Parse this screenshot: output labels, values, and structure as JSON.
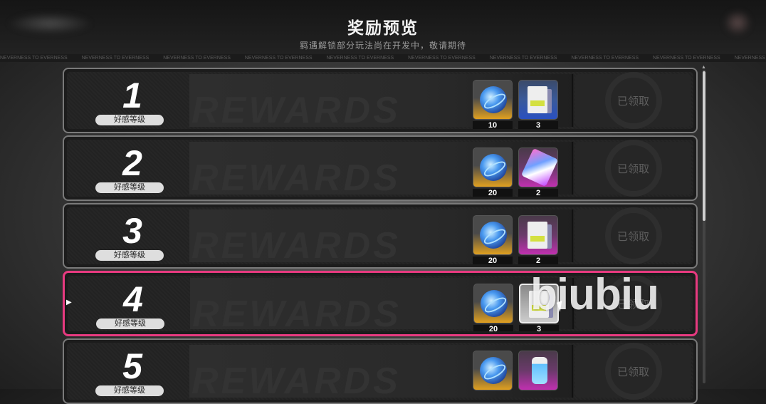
{
  "header": {
    "title": "奖励预览",
    "subtitle": "羁遇解锁部分玩法尚在开发中，敬请期待"
  },
  "ticker": {
    "text": "NEVERNESS TO EVERNESS"
  },
  "rows": [
    {
      "level": "1",
      "label": "好感等级",
      "status": "已领取",
      "items": [
        {
          "icon": "blue-orb-icon",
          "qty": "10"
        },
        {
          "icon": "blue-card-icon",
          "qty": "3"
        }
      ]
    },
    {
      "level": "2",
      "label": "好感等级",
      "status": "已领取",
      "items": [
        {
          "icon": "blue-orb-icon",
          "qty": "20"
        },
        {
          "icon": "pink-confetti-icon",
          "qty": "2"
        }
      ]
    },
    {
      "level": "3",
      "label": "好感等级",
      "status": "已领取",
      "items": [
        {
          "icon": "blue-orb-icon",
          "qty": "20"
        },
        {
          "icon": "pink-card-icon",
          "qty": "2"
        }
      ]
    },
    {
      "level": "4",
      "label": "好感等级",
      "status": "已领取",
      "items": [
        {
          "icon": "blue-orb-icon",
          "qty": "20"
        },
        {
          "icon": "white-card-icon",
          "qty": "3"
        }
      ]
    },
    {
      "level": "5",
      "label": "好感等级",
      "status": "已领取",
      "items": [
        {
          "icon": "blue-orb-icon",
          "qty": ""
        },
        {
          "icon": "potion-icon",
          "qty": ""
        }
      ]
    }
  ],
  "background_text": "REWARDS",
  "watermark": "biubiu",
  "colors": {
    "active_border": "#e83a80",
    "gold_rarity": "#e0a020",
    "blue_rarity": "#2a50c0",
    "pink_rarity": "#c030b0"
  }
}
